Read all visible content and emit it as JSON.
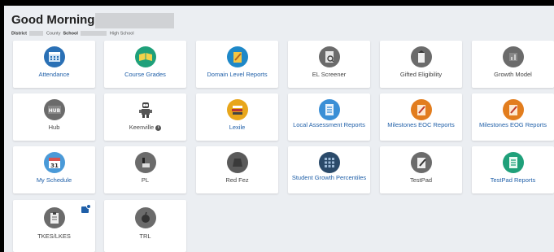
{
  "header": {
    "greeting": "Good Morning,",
    "district_label": "District",
    "county_suffix": "County",
    "school_label": "School",
    "school_suffix": "High School"
  },
  "tiles": [
    {
      "label": "Attendance",
      "icon": "calendar-grid-icon",
      "color": "#1f6fb3"
    },
    {
      "label": "Course Grades",
      "icon": "open-book-icon",
      "color": "#1fa07a"
    },
    {
      "label": "Domain Level Reports",
      "icon": "pencil-paper-icon",
      "color": "#1e88c8"
    },
    {
      "label": "EL Screener",
      "icon": "magnify-document-icon",
      "color": "#6b6b6b"
    },
    {
      "label": "Gifted Eligibility",
      "icon": "gift-icon",
      "color": "#6b6b6b"
    },
    {
      "label": "Growth Model",
      "icon": "chart-icon",
      "color": "#6b6b6b"
    },
    {
      "label": "Hub",
      "icon": "hub-icon",
      "color": "#6b6b6b"
    },
    {
      "label": "Keenville",
      "icon": "robot-icon",
      "color": "#444444"
    },
    {
      "label": "Lexile",
      "icon": "stacked-books-icon",
      "color": "#e8a61b"
    },
    {
      "label": "Local Assessment Reports",
      "icon": "checklist-icon",
      "color": "#3a8fd6"
    },
    {
      "label": "Milestones EOC Reports",
      "icon": "notepad-pencil-icon",
      "color": "#e27d1e"
    },
    {
      "label": "Milestones EOG Reports",
      "icon": "notepad-pencil-icon",
      "color": "#e27d1e"
    },
    {
      "label": "My Schedule",
      "icon": "calendar-31-icon",
      "color": "#4a9ad8"
    },
    {
      "label": "PL",
      "icon": "chair-icon",
      "color": "#6b6b6b"
    },
    {
      "label": "Red Fez",
      "icon": "fez-hat-icon",
      "color": "#5a5a5a"
    },
    {
      "label": "Student Growth Percentiles",
      "icon": "grid-icon",
      "color": "#2a4a6a"
    },
    {
      "label": "TestPad",
      "icon": "notepad-pen-icon",
      "color": "#6b6b6b"
    },
    {
      "label": "TestPad Reports",
      "icon": "document-icon",
      "color": "#1fa07a"
    },
    {
      "label": "TKES/LKES",
      "icon": "clipboard-icon",
      "color": "#6b6b6b"
    },
    {
      "label": "TRL",
      "icon": "apple-icon",
      "color": "#6b6b6b"
    }
  ],
  "keenville_info": "i",
  "schedule_day": "31"
}
